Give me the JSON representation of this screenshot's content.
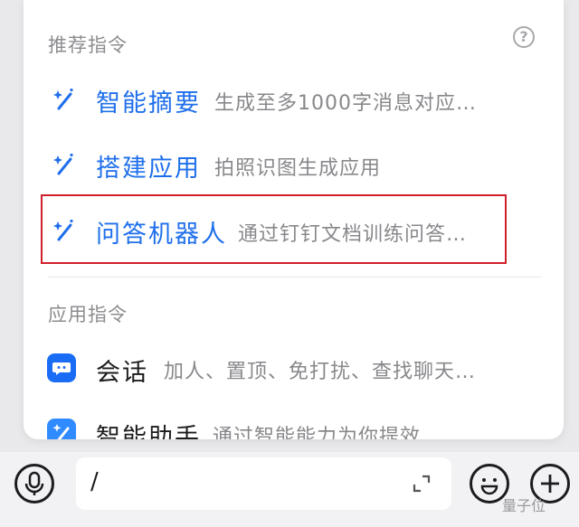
{
  "recommended": {
    "title": "推荐指令",
    "help_icon": "question-circle-icon",
    "items": [
      {
        "name": "智能摘要",
        "desc": "生成至多1000字消息对应…",
        "icon": "magic-wand-icon"
      },
      {
        "name": "搭建应用",
        "desc": "拍照识图生成应用",
        "icon": "magic-wand-icon"
      },
      {
        "name": "问答机器人",
        "desc": "通过钉钉文档训练问答…",
        "icon": "magic-wand-icon"
      }
    ]
  },
  "app_commands": {
    "title": "应用指令",
    "items": [
      {
        "name": "会话",
        "desc": "加人、置顶、免打扰、查找聊天…",
        "icon": "chat-bubble-icon"
      },
      {
        "name": "智能助手",
        "desc": "通过智能能力为你提效",
        "icon": "magic-wand-icon"
      }
    ]
  },
  "input": {
    "value": "/"
  },
  "watermark": "量子位",
  "colors": {
    "accent": "#1f6feb",
    "highlight_border": "#d0202c"
  }
}
